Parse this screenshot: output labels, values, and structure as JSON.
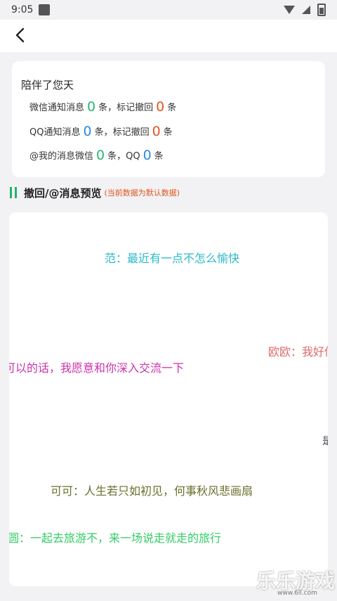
{
  "status_bar": {
    "time": "9:05"
  },
  "stats": {
    "title": "陪伴了您天",
    "wechat": {
      "prefix": "微信通知消息",
      "count1": "0",
      "mid": "条，标记撤回",
      "count2": "0",
      "suffix": "条"
    },
    "qq": {
      "prefix": "QQ通知消息",
      "count1": "0",
      "mid": "条，标记撤回",
      "count2": "0",
      "suffix": "条"
    },
    "at": {
      "prefix": "@我的消息微信",
      "count1": "0",
      "mid": "条，QQ",
      "count2": "0",
      "suffix": "条"
    },
    "colors": {
      "green": "#2bb673",
      "blue": "#2a8ae0",
      "orange": "#e0561f"
    }
  },
  "preview": {
    "title": "撤回/@消息预览",
    "note": "(当前数据为默认数据)",
    "messages": [
      {
        "text": "范：最近有一点不怎么愉快",
        "color": "#2ab8c8"
      },
      {
        "text": "欧欧：我好伤",
        "color": "#e06a6a"
      },
      {
        "text": "可以的话，我愿意和你深入交流一下",
        "color": "#cc33aa"
      },
      {
        "text": "是",
        "color": "#444444"
      },
      {
        "text": "可可：人生若只如初见，何事秋风悲画扇",
        "color": "#6b6f2a"
      },
      {
        "text": "圆：一起去旅游不，来一场说走就走的旅行",
        "color": "#33cc66"
      }
    ]
  },
  "watermark": {
    "text": "乐乐游戏",
    "url": "www.6ll.com"
  }
}
